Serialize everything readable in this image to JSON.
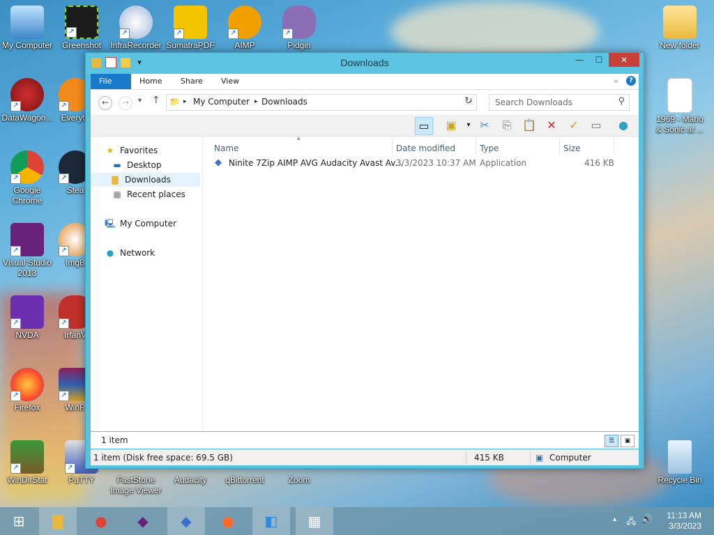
{
  "desktop": {
    "icons": [
      {
        "label": "My Computer",
        "icon": "computer-icon"
      },
      {
        "label": "Greenshot",
        "icon": "greenshot-icon"
      },
      {
        "label": "InfraRecorder",
        "icon": "infrarecorder-icon"
      },
      {
        "label": "SumatraPDF",
        "icon": "pdf-icon"
      },
      {
        "label": "AIMP",
        "icon": "aimp-icon"
      },
      {
        "label": "Pidgin",
        "icon": "pidgin-icon"
      },
      {
        "label": "New folder",
        "icon": "folder-icon"
      },
      {
        "label": "DataWagon...",
        "icon": "datawagon-icon"
      },
      {
        "label": "Everyth",
        "icon": "everything-icon"
      },
      {
        "label": "1969 - Mario & Sonic at ...",
        "icon": "file-icon"
      },
      {
        "label": "Google Chrome",
        "icon": "chrome-icon"
      },
      {
        "label": "Stea",
        "icon": "steam-icon"
      },
      {
        "label": "Visual Studio 2013",
        "icon": "visual-studio-icon"
      },
      {
        "label": "ImgB",
        "icon": "imgburn-icon"
      },
      {
        "label": "NVDA",
        "icon": "nvda-icon"
      },
      {
        "label": "IrfanV",
        "icon": "irfanview-icon"
      },
      {
        "label": "Firefox",
        "icon": "firefox-icon"
      },
      {
        "label": "WinR",
        "icon": "winrar-icon"
      },
      {
        "label": "WinDirStat",
        "icon": "windirstat-icon"
      },
      {
        "label": "PuTTY",
        "icon": "putty-icon"
      },
      {
        "label": "FastStone Image Viewer",
        "icon": "faststone-icon"
      },
      {
        "label": "Audacity",
        "icon": "audacity-icon"
      },
      {
        "label": "qBittorrent",
        "icon": "qbittorrent-icon"
      },
      {
        "label": "Zoom",
        "icon": "zoom-icon"
      },
      {
        "label": "Recycle Bin",
        "icon": "recycle-bin-icon"
      }
    ]
  },
  "window": {
    "title": "Downloads",
    "tabs": [
      "File",
      "Home",
      "Share",
      "View"
    ],
    "address": {
      "crumbs": [
        "My Computer",
        "Downloads"
      ]
    },
    "search_placeholder": "Search Downloads",
    "nav": {
      "favorites": "Favorites",
      "desktop": "Desktop",
      "downloads": "Downloads",
      "recent": "Recent places",
      "computer": "My Computer",
      "network": "Network"
    },
    "columns": {
      "name": "Name",
      "date": "Date modified",
      "type": "Type",
      "size": "Size"
    },
    "files": [
      {
        "name": "Ninite 7Zip AIMP AVG Audacity Avast Av...",
        "date": "3/3/2023 10:37 AM",
        "type": "Application",
        "size": "416 KB"
      }
    ],
    "item_count": "1 item",
    "status": {
      "left": "1 item (Disk free space: 69.5 GB)",
      "size": "415 KB",
      "location": "Computer"
    }
  },
  "taskbar": {
    "clock_time": "11:13 AM",
    "clock_date": "3/3/2023"
  },
  "colors": {
    "accent": "#1979ca",
    "titlebar": "#5cc3e0",
    "close": "#c7403a"
  }
}
